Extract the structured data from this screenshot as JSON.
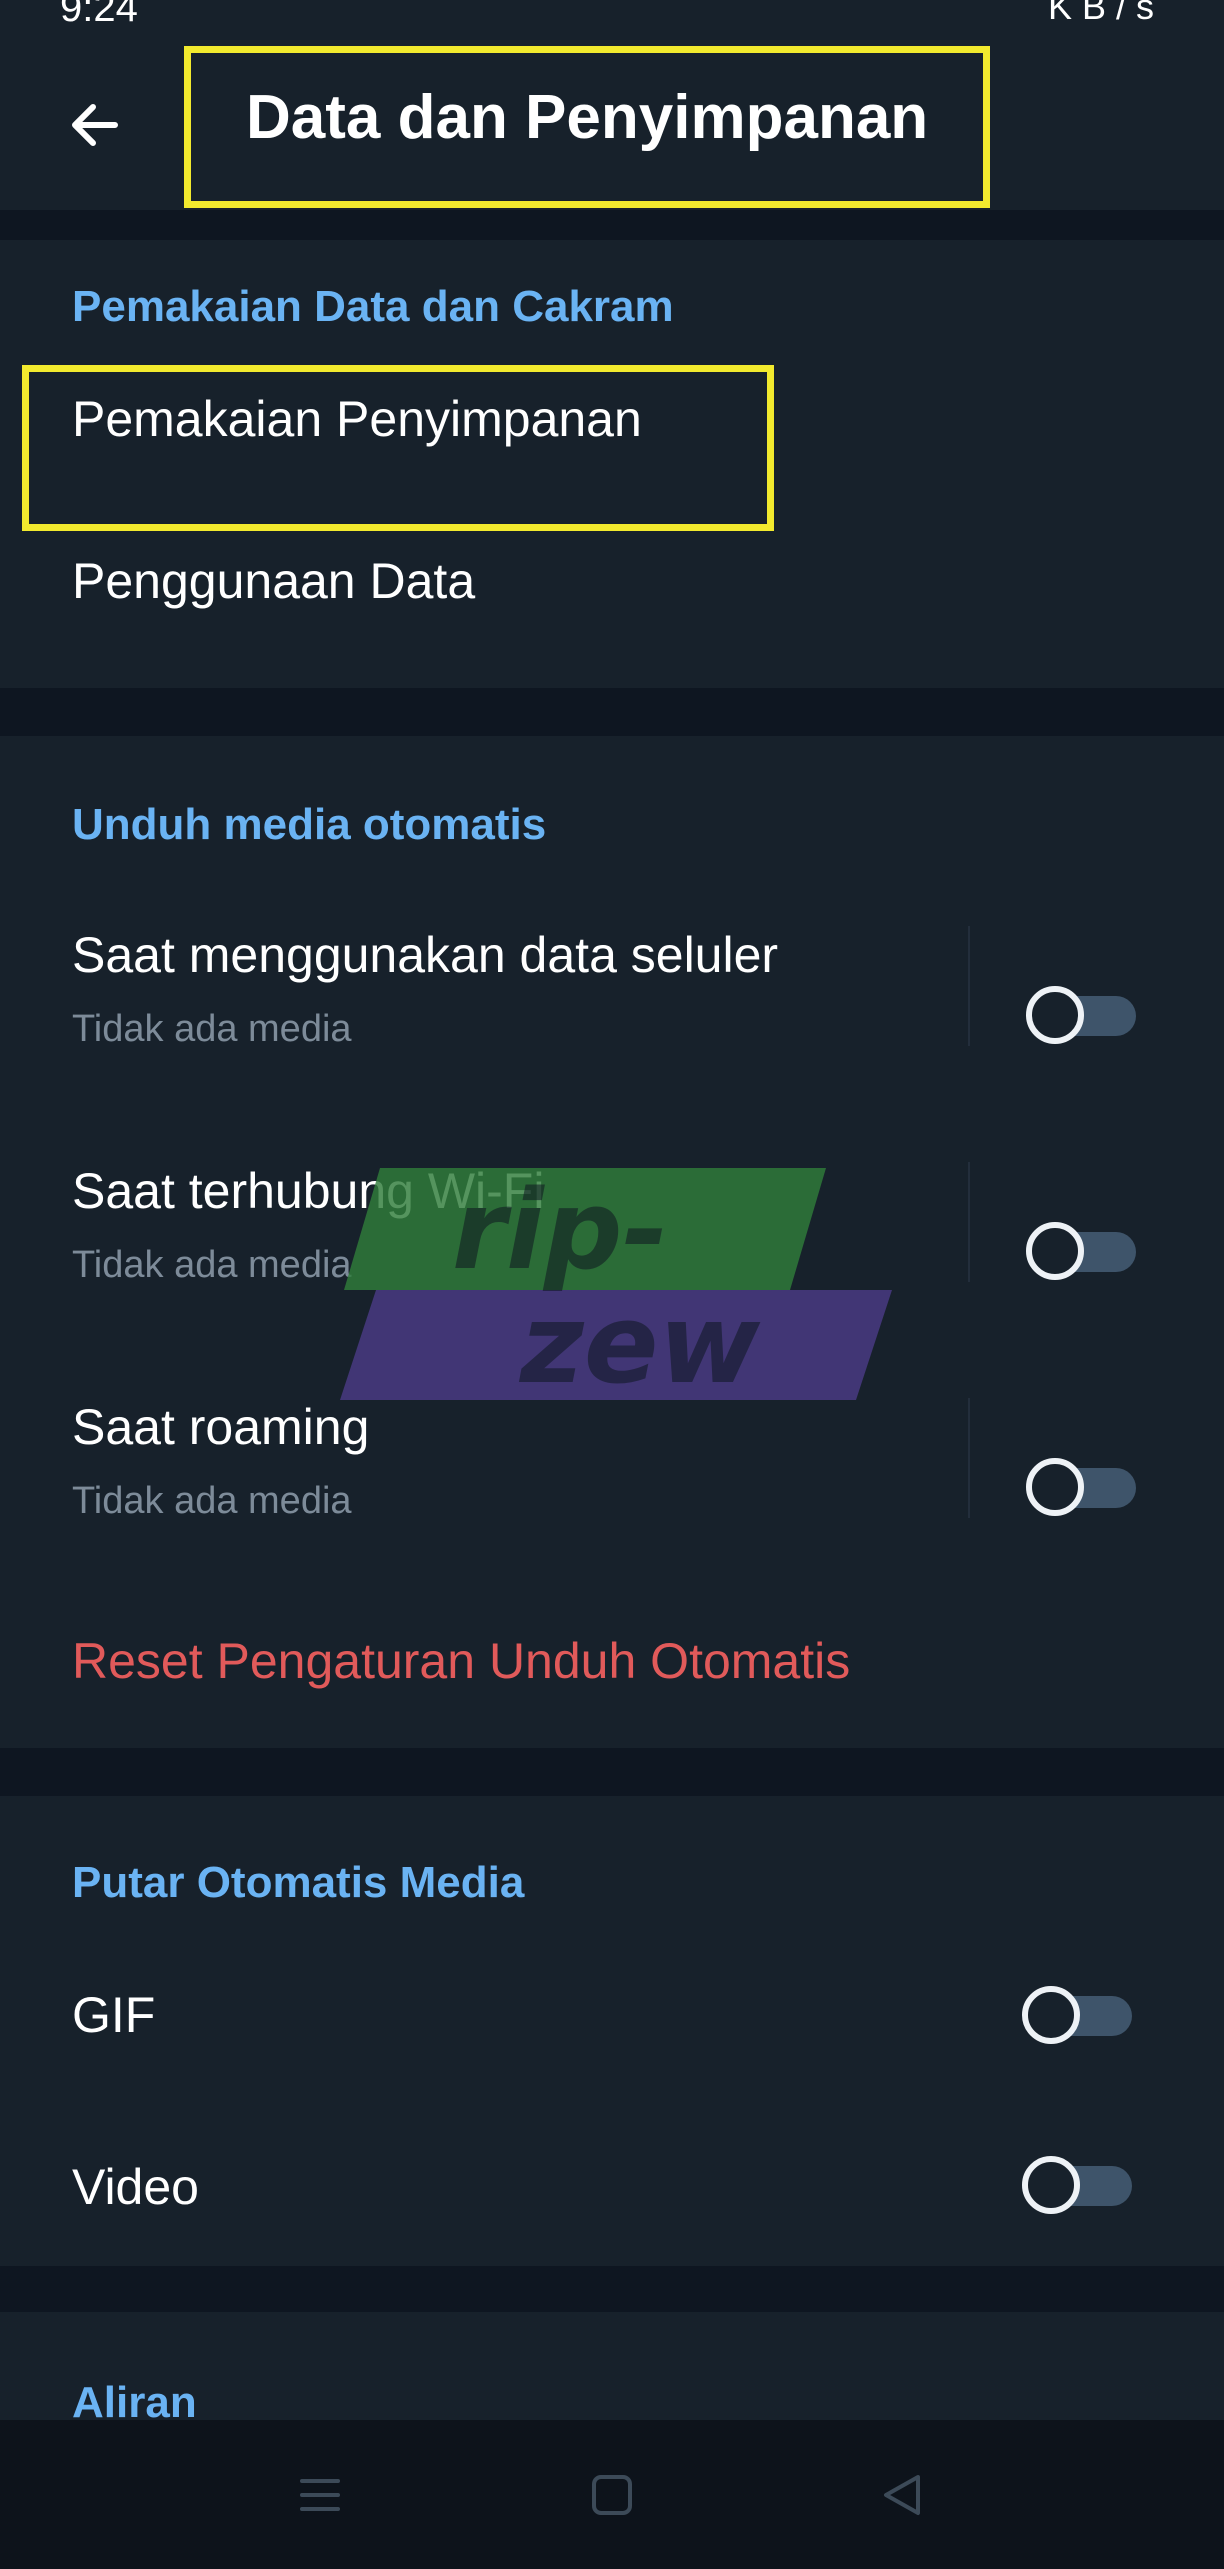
{
  "status_bar": {
    "time": "9:24",
    "right": "KB/s"
  },
  "app_bar": {
    "title": "Data dan Penyimpanan",
    "back_icon": "arrow-left-icon"
  },
  "section_data_disk": {
    "header": "Pemakaian Data dan Cakram",
    "items": [
      {
        "label": "Pemakaian Penyimpanan"
      },
      {
        "label": "Penggunaan Data"
      }
    ]
  },
  "section_auto_download": {
    "header": "Unduh media otomatis",
    "items": [
      {
        "label": "Saat menggunakan data seluler",
        "sub": "Tidak ada media",
        "enabled": false
      },
      {
        "label": "Saat terhubung Wi-Fi",
        "sub": "Tidak ada media",
        "enabled": false
      },
      {
        "label": "Saat roaming",
        "sub": "Tidak ada media",
        "enabled": false
      }
    ],
    "reset_label": "Reset Pengaturan Unduh Otomatis"
  },
  "section_autoplay": {
    "header": "Putar Otomatis Media",
    "items": [
      {
        "label": "GIF",
        "enabled": false
      },
      {
        "label": "Video",
        "enabled": false
      }
    ]
  },
  "section_stream": {
    "header": "Aliran"
  },
  "watermark": {
    "line1": "rip-",
    "line2": "zew"
  },
  "nav_bar": {
    "icons": [
      "menu-icon",
      "home-square-icon",
      "back-triangle-icon"
    ]
  },
  "colors": {
    "background": "#0e1621",
    "section_bg": "#17212b",
    "accent_blue": "#6ab3f3",
    "danger_red": "#e15a5a",
    "subtitle_gray": "#7d8b99",
    "highlight_yellow": "#f2ea2e"
  }
}
